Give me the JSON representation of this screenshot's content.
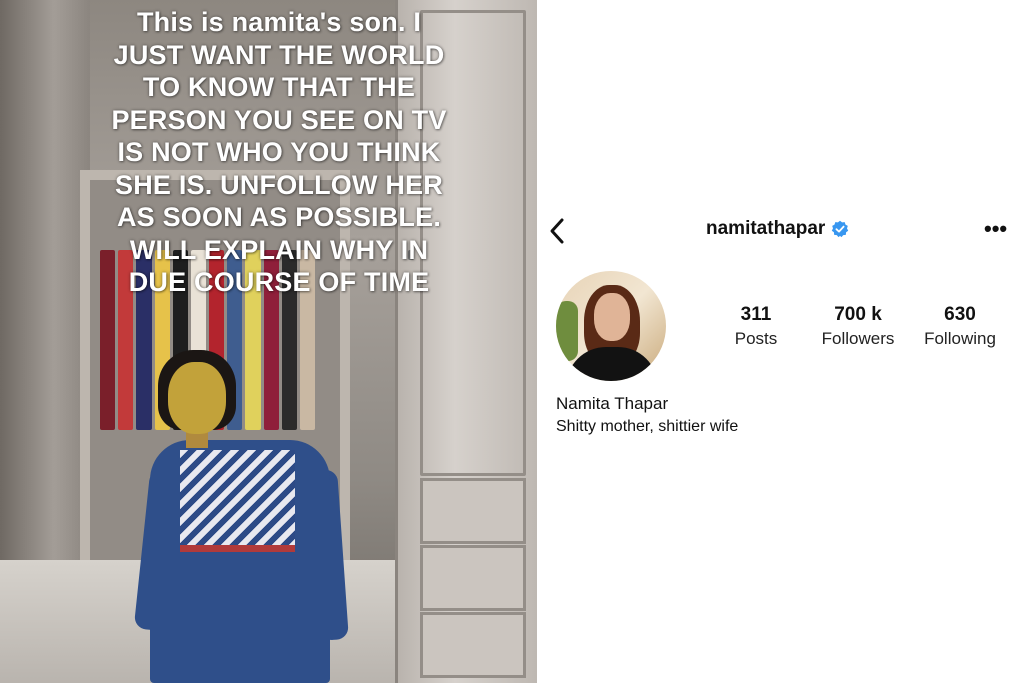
{
  "story": {
    "lines": [
      "This is namita's son. I",
      "JUST WANT THE WORLD",
      "TO KNOW THAT THE",
      "PERSON YOU SEE ON TV",
      "IS NOT WHO YOU THINK",
      "SHE IS. UNFOLLOW HER",
      "AS SOON AS POSSIBLE.",
      "WILL EXPLAIN WHY IN",
      "DUE COURSE OF TIME"
    ]
  },
  "profile": {
    "username": "namitathapar",
    "verified": true,
    "back_icon": "chevron-left-icon",
    "more_icon": "more-horizontal-icon",
    "more_label": "•••",
    "stats": [
      {
        "value": "311",
        "label": "Posts"
      },
      {
        "value": "700 k",
        "label": "Followers"
      },
      {
        "value": "630",
        "label": "Following"
      }
    ],
    "display_name": "Namita Thapar",
    "bio": "Shitty mother, shittier wife"
  },
  "colors": {
    "verified_badge": "#3897f0",
    "text": "#111111",
    "story_text": "#ffffff"
  }
}
